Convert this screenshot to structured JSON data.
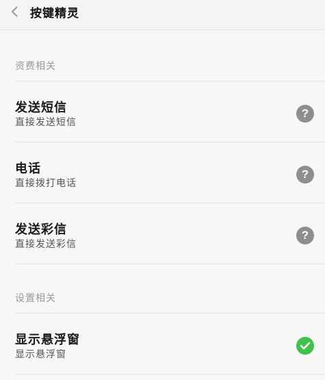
{
  "header": {
    "title": "按键精灵"
  },
  "sections": [
    {
      "label": "资费相关",
      "items": [
        {
          "title": "发送短信",
          "subtitle": "直接发送短信",
          "icon": "help-icon"
        },
        {
          "title": "电话",
          "subtitle": "直接拨打电话",
          "icon": "help-icon"
        },
        {
          "title": "发送彩信",
          "subtitle": "直接发送彩信",
          "icon": "help-icon"
        }
      ]
    },
    {
      "label": "设置相关",
      "items": [
        {
          "title": "显示悬浮窗",
          "subtitle": "显示悬浮窗",
          "icon": "check-circle-icon",
          "checked": true
        }
      ]
    }
  ],
  "colors": {
    "help_icon_bg": "#8e8e8e",
    "check_icon_bg": "#3ec24b",
    "section_label": "#9a9a9a"
  }
}
